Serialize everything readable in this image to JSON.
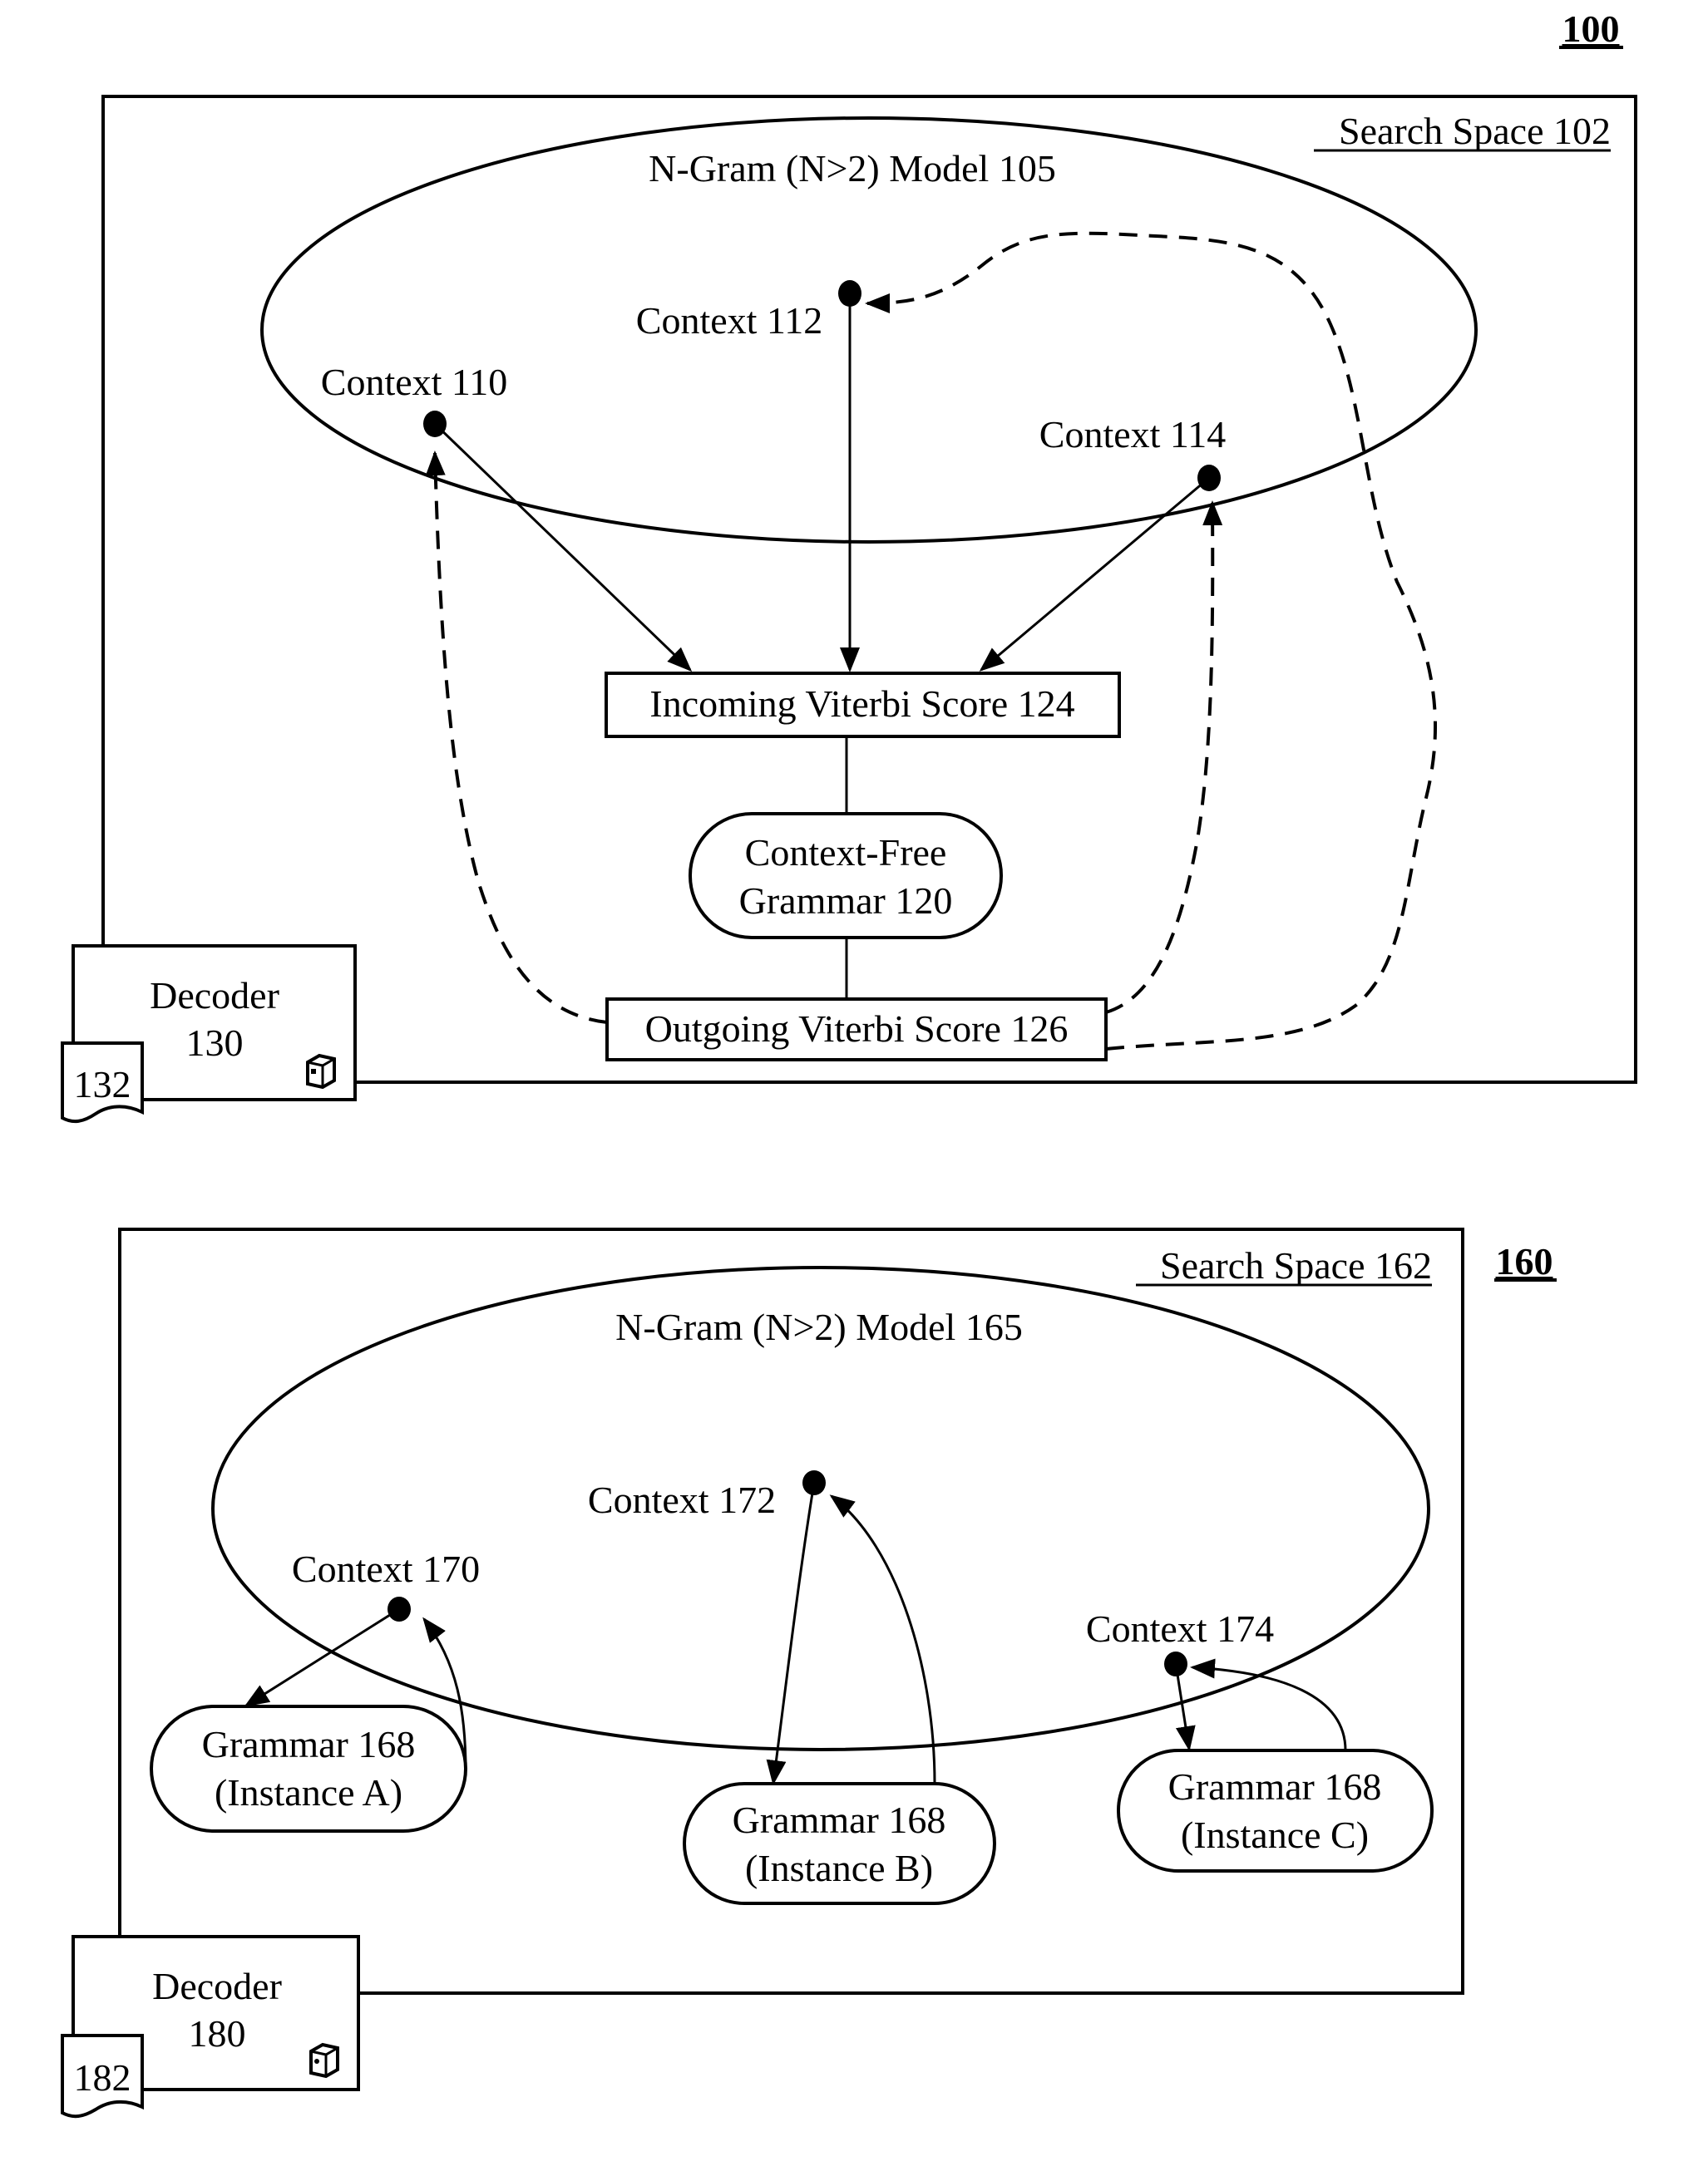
{
  "figure_top": {
    "reference": "100",
    "search_space_label": "Search Space 102",
    "ngram_model_label": "N-Gram (N>2) Model 105",
    "contexts": [
      {
        "id": "110",
        "label": "Context 110"
      },
      {
        "id": "112",
        "label": "Context 112"
      },
      {
        "id": "114",
        "label": "Context 114"
      }
    ],
    "incoming_score_label": "Incoming Viterbi Score 124",
    "grammar_label_line1": "Context-Free",
    "grammar_label_line2": "Grammar 120",
    "outgoing_score_label": "Outgoing Viterbi Score 126",
    "decoder_line1": "Decoder",
    "decoder_line2": "130",
    "document_label": "132",
    "decoder_icon": "computer-tower-icon"
  },
  "figure_bottom": {
    "reference": "160",
    "search_space_label": "Search Space 162",
    "ngram_model_label": "N-Gram (N>2) Model 165",
    "contexts": [
      {
        "id": "170",
        "label": "Context 170"
      },
      {
        "id": "172",
        "label": "Context 172"
      },
      {
        "id": "174",
        "label": "Context 174"
      }
    ],
    "grammar_instances": [
      {
        "line1": "Grammar 168",
        "line2": "(Instance A)"
      },
      {
        "line1": "Grammar 168",
        "line2": "(Instance B)"
      },
      {
        "line1": "Grammar 168",
        "line2": "(Instance C)"
      }
    ],
    "decoder_line1": "Decoder",
    "decoder_line2": "180",
    "document_label": "182",
    "decoder_icon": "computer-tower-icon"
  }
}
